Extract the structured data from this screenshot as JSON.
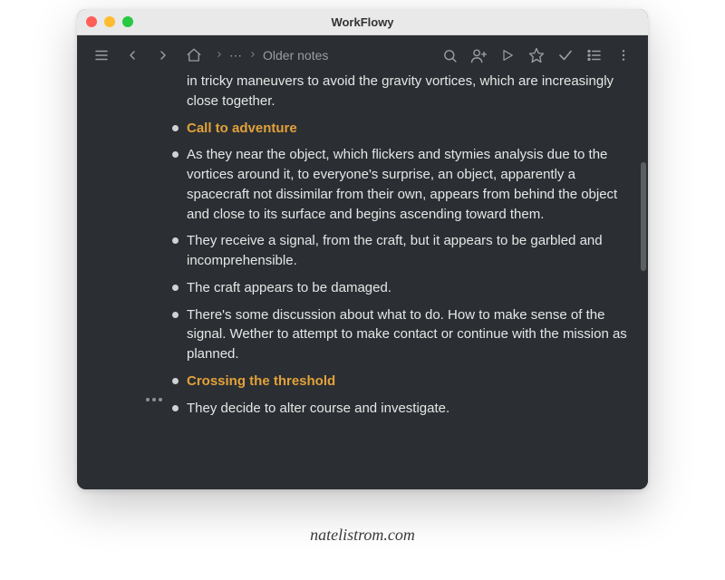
{
  "window": {
    "title": "WorkFlowy"
  },
  "breadcrumb": {
    "label": "Older notes"
  },
  "items": [
    {
      "text": "in tricky maneuvers to avoid the gravity vortices, which are increasingly close together.",
      "heading": false,
      "continuation": true
    },
    {
      "text": "Call to adventure",
      "heading": true,
      "continuation": false
    },
    {
      "text": "As they near the object, which flickers and stymies analysis due to the vortices around it, to everyone's surprise, an object, apparently a spacecraft not dissimilar from their own, appears from behind the object and close to its surface and begins ascending toward them.",
      "heading": false,
      "continuation": false
    },
    {
      "text": "They receive a signal, from the craft, but it appears to be garbled and incomprehensible.",
      "heading": false,
      "continuation": false
    },
    {
      "text": "The craft appears to be damaged.",
      "heading": false,
      "continuation": false
    },
    {
      "text": "There's some discussion about what to do. How to make sense of the signal. Wether to attempt to make contact or continue with the mission as planned.",
      "heading": false,
      "continuation": false
    },
    {
      "text": "Crossing the threshold",
      "heading": true,
      "continuation": false
    },
    {
      "text": "They decide to alter course and investigate.",
      "heading": false,
      "continuation": false
    }
  ],
  "caption": "natelistrom.com"
}
